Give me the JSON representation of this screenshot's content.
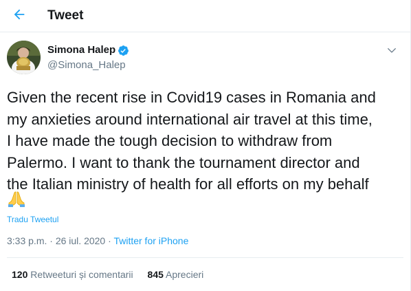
{
  "header": {
    "title": "Tweet",
    "back_icon": "arrow-left-icon",
    "accent": "#1da1f2"
  },
  "author": {
    "name": "Simona Halep",
    "handle": "@Simona_Halep",
    "verified": true,
    "verified_icon": "verified-badge-icon",
    "menu_icon": "chevron-down-icon"
  },
  "tweet": {
    "text": "Given the recent rise in Covid19 cases in Romania and\nmy anxieties around international air travel at this time,\nI have made the tough decision to withdraw from\nPalermo. I want to thank the tournament director and\nthe Italian ministry of health for all efforts on my behalf",
    "emoji": "🙏",
    "emoji_icon": "folded-hands-icon",
    "translate_label": "Tradu Tweetul"
  },
  "meta": {
    "time": "3:33 p.m.",
    "separator": " · ",
    "date": "26 iul. 2020",
    "source": "Twitter for iPhone"
  },
  "stats": {
    "retweets_count": "120",
    "retweets_label": "Retweeturi și comentarii",
    "likes_count": "845",
    "likes_label": "Aprecieri"
  },
  "colors": {
    "text": "#14171a",
    "secondary": "#657786",
    "link": "#1da1f2",
    "border": "#e6ecf0"
  }
}
